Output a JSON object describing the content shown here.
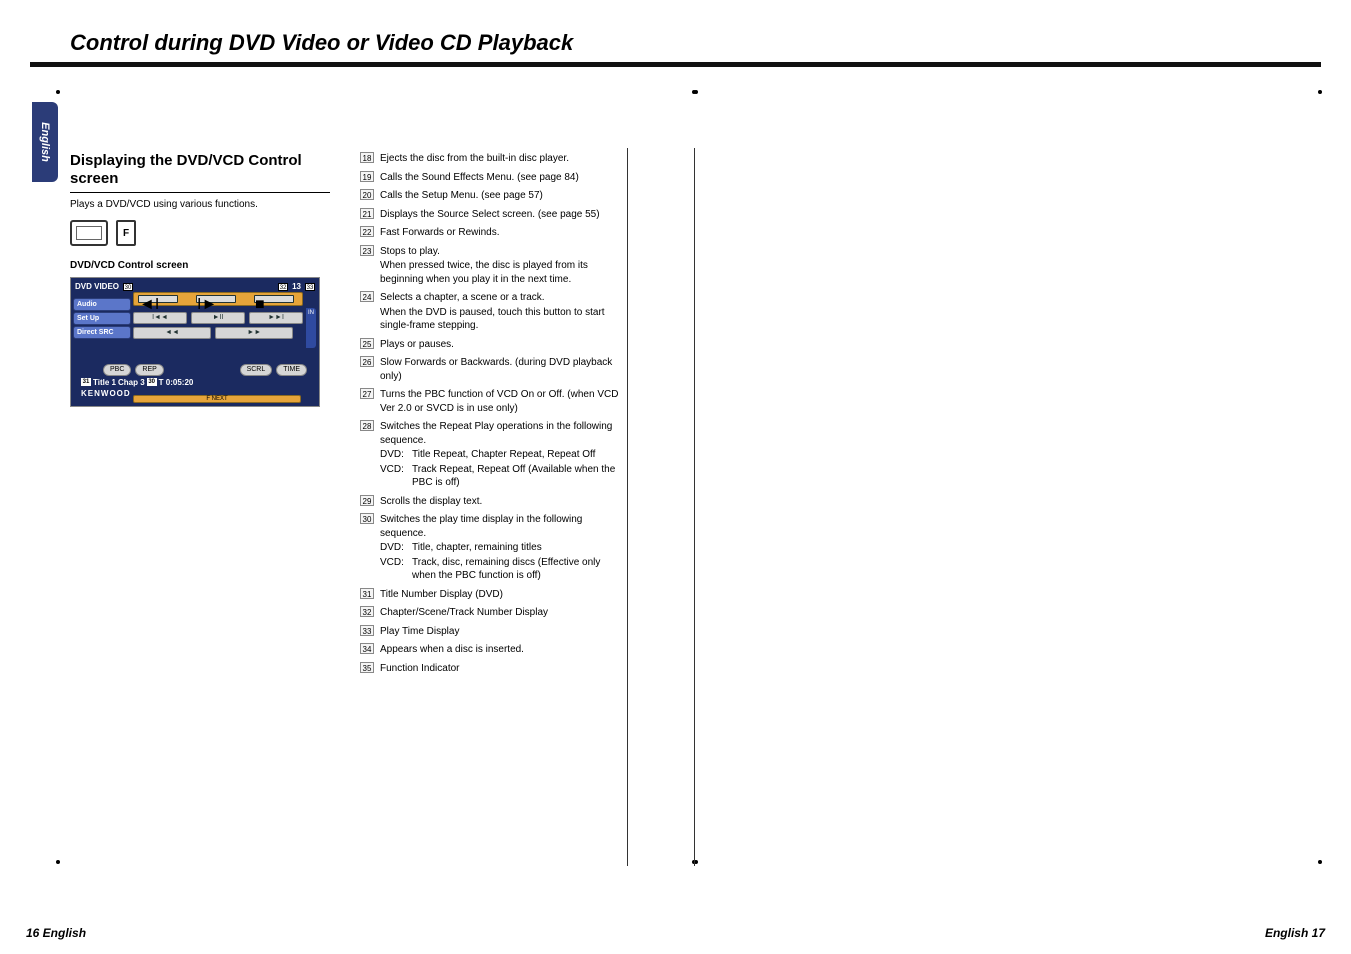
{
  "lang_tab": "English",
  "page_title": "Control during DVD Video or Video CD Playback",
  "section_header": "Displaying the DVD/VCD Control screen",
  "intro": "Plays a DVD/VCD using various functions.",
  "screenshot_label": "DVD/VCD Control screen",
  "screenshot": {
    "title": "DVD VIDEO",
    "side_buttons": [
      "Audio",
      "Set Up",
      "Direct SRC"
    ],
    "pills": [
      "PBC",
      "REP",
      "SCRL",
      "TIME"
    ],
    "status": {
      "title": "Title  1",
      "chap": "Chap     3",
      "time": "T 0:05:20"
    },
    "brand": "KENWOOD",
    "fnext": "F NEXT",
    "in": "IN",
    "display_num": "13",
    "f_key": "F"
  },
  "items": [
    {
      "num": "18",
      "text": "Ejects the disc from the built-in disc player."
    },
    {
      "num": "19",
      "text": "Calls the Sound Effects Menu. (see page 84)"
    },
    {
      "num": "20",
      "text": "Calls the Setup Menu. (see page 57)"
    },
    {
      "num": "21",
      "text": "Displays the Source Select screen. (see page 55)"
    },
    {
      "num": "22",
      "text": "Fast Forwards or Rewinds."
    },
    {
      "num": "23",
      "text": "Stops to play.",
      "extra": "When pressed twice, the disc is played from its beginning when you play it in the next time."
    },
    {
      "num": "24",
      "text": "Selects a chapter, a scene or a track.",
      "extra": "When the DVD is paused, touch this button to start single-frame stepping."
    },
    {
      "num": "25",
      "text": "Plays or pauses."
    },
    {
      "num": "26",
      "text": "Slow Forwards or Backwards. (during DVD playback only)"
    },
    {
      "num": "27",
      "text": "Turns the PBC function of VCD On or Off. (when VCD Ver 2.0 or SVCD is in use only)"
    },
    {
      "num": "28",
      "text": "Switches the Repeat Play operations in the following sequence.",
      "sub": [
        {
          "k": "DVD:",
          "v": "Title Repeat, Chapter Repeat, Repeat Off"
        },
        {
          "k": "VCD:",
          "v": "Track Repeat, Repeat Off (Available when the PBC is off)"
        }
      ]
    },
    {
      "num": "29",
      "text": "Scrolls the display text."
    },
    {
      "num": "30",
      "text": "Switches the play time display in the following sequence.",
      "sub": [
        {
          "k": "DVD:",
          "v": "Title, chapter, remaining titles"
        },
        {
          "k": "VCD:",
          "v": "Track, disc, remaining discs (Effective only when the PBC function is off)"
        }
      ]
    },
    {
      "num": "31",
      "text": "Title Number Display (DVD)"
    },
    {
      "num": "32",
      "text": "Chapter/Scene/Track Number Display"
    },
    {
      "num": "33",
      "text": "Play Time Display"
    },
    {
      "num": "34",
      "text": "Appears when a disc is inserted."
    },
    {
      "num": "35",
      "text": "Function Indicator"
    }
  ],
  "footer_left": "16 English",
  "footer_right": "English 17"
}
